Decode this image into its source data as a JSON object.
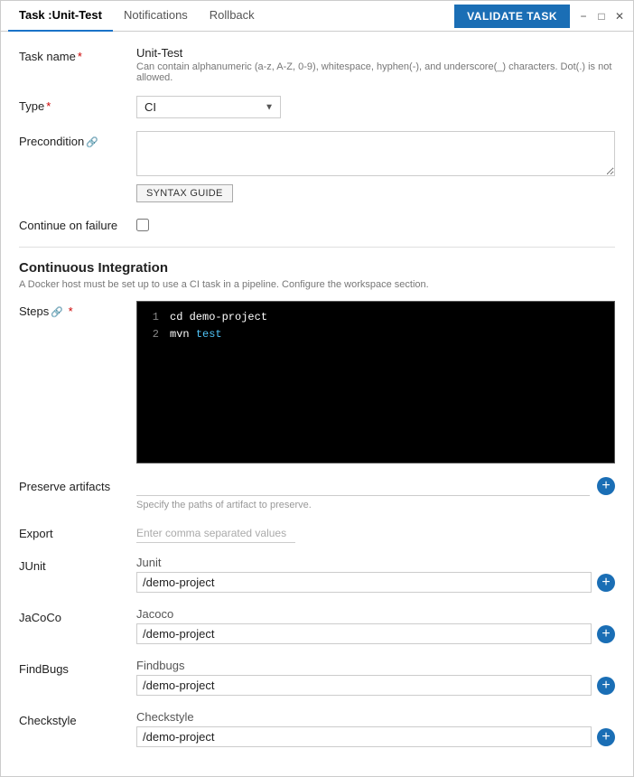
{
  "header": {
    "task_label": "Task :",
    "task_name": "Unit-Test",
    "tabs": [
      {
        "id": "notifications",
        "label": "Notifications"
      },
      {
        "id": "rollback",
        "label": "Rollback"
      }
    ],
    "validate_btn": "VALIDATE TASK"
  },
  "form": {
    "task_name_label": "Task name",
    "task_name_value": "Unit-Test",
    "task_name_hint": "Can contain alphanumeric (a-z, A-Z, 0-9), whitespace, hyphen(-), and underscore(_) characters. Dot(.) is not allowed.",
    "type_label": "Type",
    "type_value": "CI",
    "precondition_label": "Precondition",
    "precondition_placeholder": "",
    "syntax_guide_btn": "SYNTAX GUIDE",
    "continue_on_failure_label": "Continue on failure"
  },
  "ci_section": {
    "title": "Continuous Integration",
    "hint": "A Docker host must be set up to use a CI task in a pipeline. Configure the workspace section.",
    "steps_label": "Steps",
    "code_lines": [
      {
        "num": "1",
        "content": "cd demo-project"
      },
      {
        "num": "2",
        "content": "mvn test"
      }
    ]
  },
  "artifacts": {
    "preserve_label": "Preserve artifacts",
    "preserve_placeholder": "",
    "preserve_hint": "Specify the paths of artifact to preserve.",
    "export_label": "Export",
    "export_placeholder": "Enter comma separated values",
    "junit_label": "JUnit",
    "junit_sub": "Junit",
    "junit_path": "/demo-project",
    "jacoco_label": "JaCoCo",
    "jacoco_sub": "Jacoco",
    "jacoco_path": "/demo-project",
    "findbugs_label": "FindBugs",
    "findbugs_sub": "Findbugs",
    "findbugs_path": "/demo-project",
    "checkstyle_label": "Checkstyle",
    "checkstyle_sub": "Checkstyle",
    "checkstyle_path": "/demo-project"
  }
}
